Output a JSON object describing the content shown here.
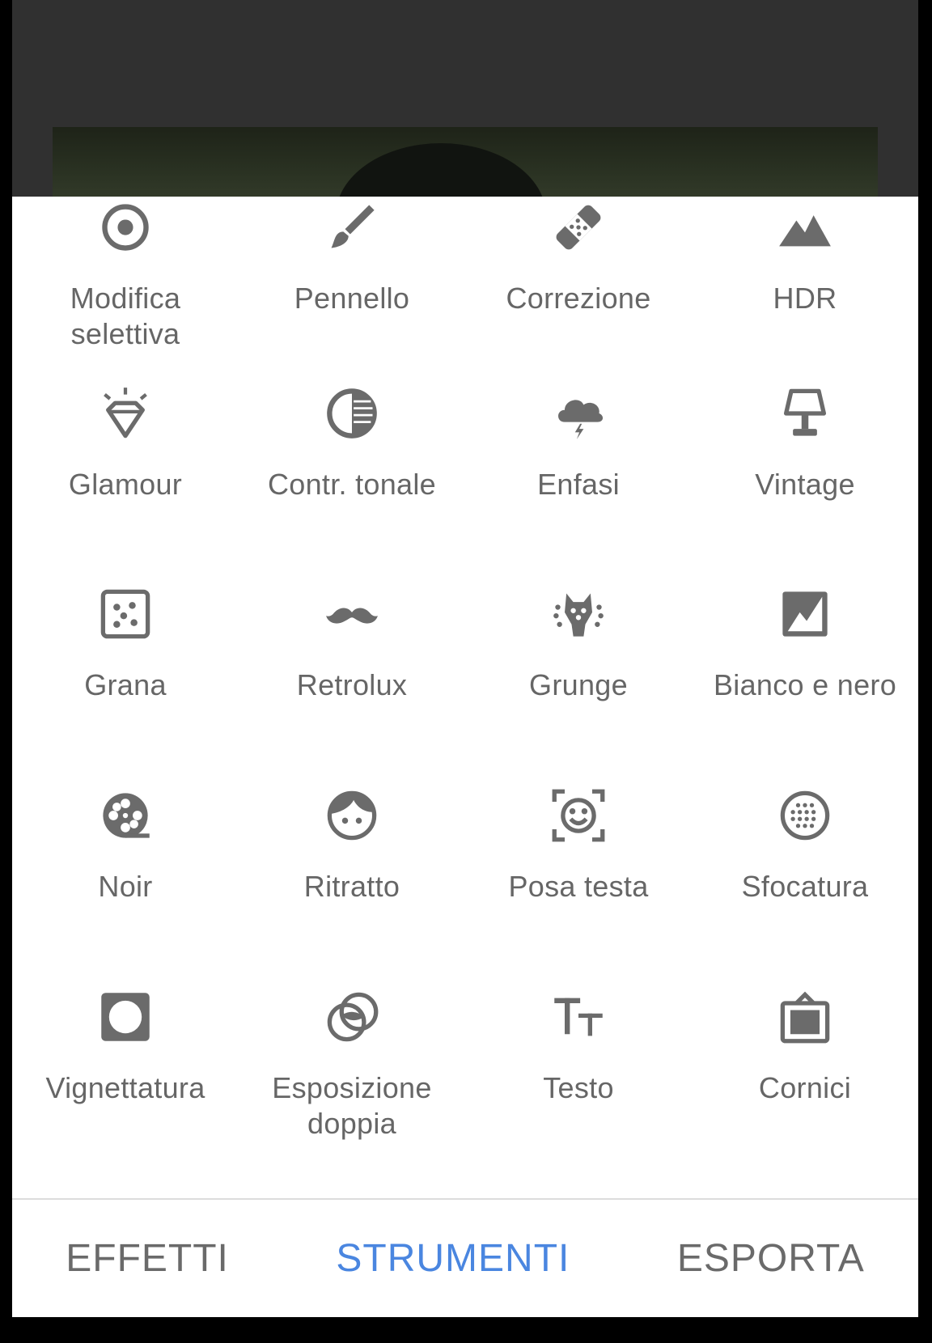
{
  "tools": [
    {
      "label": "Modifica selettiva",
      "icon": "selective-icon"
    },
    {
      "label": "Pennello",
      "icon": "brush-icon"
    },
    {
      "label": "Correzione",
      "icon": "healing-icon"
    },
    {
      "label": "HDR",
      "icon": "hdr-mountain-icon"
    },
    {
      "label": "Glamour",
      "icon": "glamour-diamond-icon"
    },
    {
      "label": "Contr. tonale",
      "icon": "tonal-contrast-icon"
    },
    {
      "label": "Enfasi",
      "icon": "drama-cloud-icon"
    },
    {
      "label": "Vintage",
      "icon": "vintage-lamp-icon"
    },
    {
      "label": "Grana",
      "icon": "grainy-film-icon"
    },
    {
      "label": "Retrolux",
      "icon": "retrolux-mustache-icon"
    },
    {
      "label": "Grunge",
      "icon": "grunge-icon"
    },
    {
      "label": "Bianco e nero",
      "icon": "black-white-icon"
    },
    {
      "label": "Noir",
      "icon": "noir-film-reel-icon"
    },
    {
      "label": "Ritratto",
      "icon": "portrait-face-icon"
    },
    {
      "label": "Posa testa",
      "icon": "head-pose-icon"
    },
    {
      "label": "Sfocatura",
      "icon": "lens-blur-icon"
    },
    {
      "label": "Vignettatura",
      "icon": "vignette-icon"
    },
    {
      "label": "Esposizione doppia",
      "icon": "double-exposure-icon"
    },
    {
      "label": "Testo",
      "icon": "text-icon"
    },
    {
      "label": "Cornici",
      "icon": "frames-icon"
    }
  ],
  "tabs": [
    {
      "label": "EFFETTI",
      "active": false
    },
    {
      "label": "STRUMENTI",
      "active": true
    },
    {
      "label": "ESPORTA",
      "active": false
    }
  ],
  "colors": {
    "icon": "#6b6b6b",
    "label": "#666666",
    "active_tab": "#4a86e0"
  }
}
